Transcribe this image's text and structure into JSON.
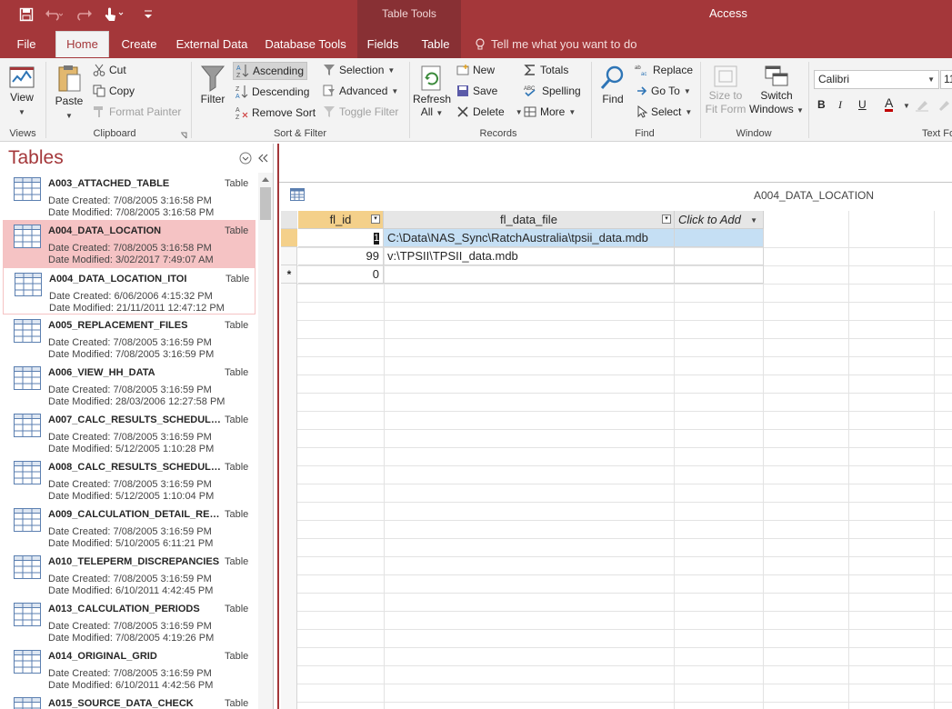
{
  "window": {
    "app_title": "Access",
    "context_group": "Table Tools"
  },
  "tabs": [
    {
      "label": "File"
    },
    {
      "label": "Home"
    },
    {
      "label": "Create"
    },
    {
      "label": "External Data"
    },
    {
      "label": "Database Tools"
    },
    {
      "label": "Fields"
    },
    {
      "label": "Table"
    }
  ],
  "tell_me": "Tell me what you want to do",
  "ribbon": {
    "groups": {
      "views": "Views",
      "clipboard": "Clipboard",
      "sort_filter": "Sort & Filter",
      "records": "Records",
      "find": "Find",
      "window": "Window",
      "text": "Text Fo"
    },
    "view": "View",
    "paste": "Paste",
    "cut": "Cut",
    "copy": "Copy",
    "format_painter": "Format Painter",
    "filter": "Filter",
    "ascending": "Ascending",
    "descending": "Descending",
    "remove_sort": "Remove Sort",
    "selection": "Selection",
    "advanced": "Advanced",
    "toggle_filter": "Toggle Filter",
    "refresh_all_1": "Refresh",
    "refresh_all_2": "All",
    "new": "New",
    "save": "Save",
    "delete": "Delete",
    "totals": "Totals",
    "spelling": "Spelling",
    "more": "More",
    "find": "Find",
    "replace": "Replace",
    "goto": "Go To",
    "select": "Select",
    "size_to_fit_1": "Size to",
    "size_to_fit_2": "Fit Form",
    "switch_windows_1": "Switch",
    "switch_windows_2": "Windows",
    "font_name": "Calibri",
    "font_size": "11",
    "bold": "B",
    "italic": "I",
    "underline": "U",
    "font_color": "A"
  },
  "nav": {
    "title": "Tables",
    "items": [
      {
        "name": "A003_ATTACHED_TABLE",
        "type": "Table",
        "created": "Date Created: 7/08/2005 3:16:58 PM",
        "modified": "Date Modified: 7/08/2005 3:16:58 PM"
      },
      {
        "name": "A004_DATA_LOCATION",
        "type": "Table",
        "created": "Date Created: 7/08/2005 3:16:58 PM",
        "modified": "Date Modified: 3/02/2017 7:49:07 AM"
      },
      {
        "name": "A004_DATA_LOCATION_ITOI",
        "type": "Table",
        "created": "Date Created: 6/06/2006 4:15:32 PM",
        "modified": "Date Modified: 21/11/2011 12:47:12 PM"
      },
      {
        "name": "A005_REPLACEMENT_FILES",
        "type": "Table",
        "created": "Date Created: 7/08/2005 3:16:59 PM",
        "modified": "Date Modified: 7/08/2005 3:16:59 PM"
      },
      {
        "name": "A006_VIEW_HH_DATA",
        "type": "Table",
        "created": "Date Created: 7/08/2005 3:16:59 PM",
        "modified": "Date Modified: 28/03/2006 12:27:58 PM"
      },
      {
        "name": "A007_CALC_RESULTS_SCHEDULE14",
        "type": "Table",
        "created": "Date Created: 7/08/2005 3:16:59 PM",
        "modified": "Date Modified: 5/12/2005 1:10:28 PM"
      },
      {
        "name": "A008_CALC_RESULTS_SCHEDULE7",
        "type": "Table",
        "created": "Date Created: 7/08/2005 3:16:59 PM",
        "modified": "Date Modified: 5/12/2005 1:10:04 PM"
      },
      {
        "name": "A009_CALCULATION_DETAIL_REPO...",
        "type": "Table",
        "created": "Date Created: 7/08/2005 3:16:59 PM",
        "modified": "Date Modified: 5/10/2005 6:11:21 PM"
      },
      {
        "name": "A010_TELEPERM_DISCREPANCIES",
        "type": "Table",
        "created": "Date Created: 7/08/2005 3:16:59 PM",
        "modified": "Date Modified: 6/10/2011 4:42:45 PM"
      },
      {
        "name": "A013_CALCULATION_PERIODS",
        "type": "Table",
        "created": "Date Created: 7/08/2005 3:16:59 PM",
        "modified": "Date Modified: 7/08/2005 4:19:26 PM"
      },
      {
        "name": "A014_ORIGINAL_GRID",
        "type": "Table",
        "created": "Date Created: 7/08/2005 3:16:59 PM",
        "modified": "Date Modified: 6/10/2011 4:42:56 PM"
      },
      {
        "name": "A015_SOURCE_DATA_CHECK",
        "type": "Table",
        "created": "",
        "modified": ""
      }
    ]
  },
  "document": {
    "title": "A004_DATA_LOCATION",
    "columns": [
      "fl_id",
      "fl_data_file",
      "Click to Add"
    ],
    "rows": [
      {
        "fl_id": "1",
        "fl_data_file": "C:\\Data\\NAS_Sync\\RatchAustralia\\tpsii_data.mdb"
      },
      {
        "fl_id": "99",
        "fl_data_file": "v:\\TPSII\\TPSII_data.mdb"
      }
    ],
    "new_row": {
      "marker": "*",
      "fl_id": "0"
    }
  }
}
